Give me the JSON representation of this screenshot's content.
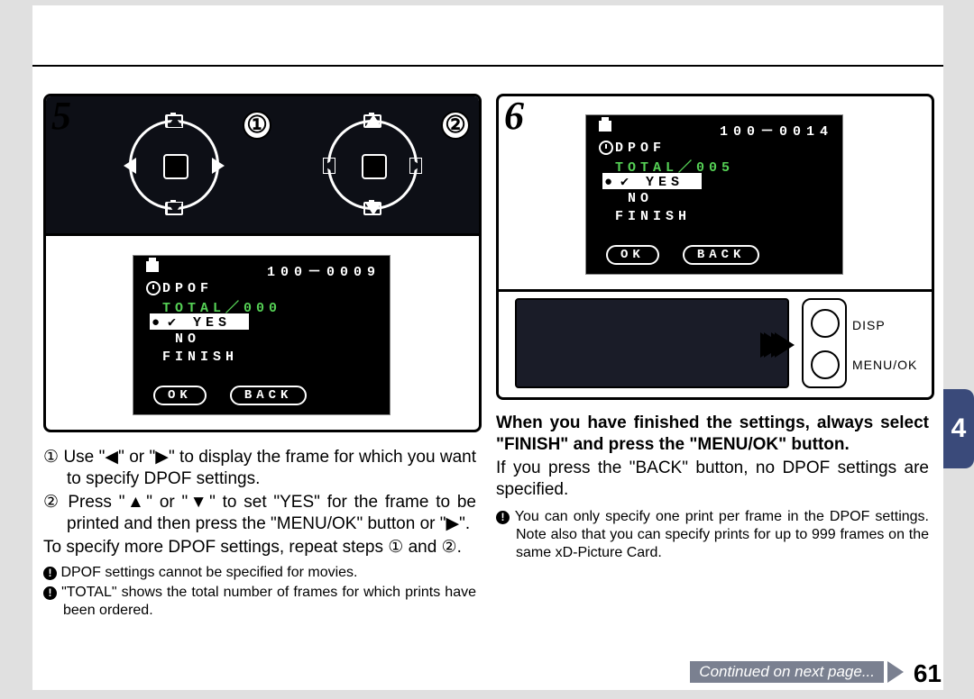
{
  "page_number": "61",
  "side_tab": "4",
  "continued": "Continued on next page...",
  "step5": {
    "num": "5",
    "circ1": "①",
    "circ2": "②",
    "lcd": {
      "file": "100－0009",
      "dpof": "DPOF",
      "total": "TOTAL／000",
      "yes": "✔ YES",
      "no": "NO",
      "finish": "FINISH",
      "ok": "OK",
      "back": "BACK"
    }
  },
  "step6": {
    "num": "6",
    "lcd": {
      "file": "100－0014",
      "dpof": "DPOF",
      "total": "TOTAL／005",
      "yes": "✔ YES",
      "no": "NO",
      "finish": "FINISH",
      "ok": "OK",
      "back": "BACK"
    },
    "btn_disp": "DISP",
    "btn_menu": "MENU/OK"
  },
  "text5": {
    "l1": "① Use \"◀\" or \"▶\" to display the frame for which you want to specify DPOF settings.",
    "l2": "② Press \"▲\" or \"▼\" to set \"YES\" for the frame to be printed and then press the \"MENU/OK\" button or \"▶\".",
    "l3": "To specify more DPOF settings, repeat steps ① and ②.",
    "n1": "DPOF settings cannot be specified for movies.",
    "n2": "\"TOTAL\" shows the total number of frames for which prints have been ordered."
  },
  "text6": {
    "b1": "When you have finished the settings, always select \"FINISH\" and press the \"MENU/OK\" button.",
    "p1": "If you press the \"BACK\" button, no DPOF settings are specified.",
    "n1": "You can only specify one print per frame in the DPOF settings. Note also that you can specify prints for up to 999 frames on the same xD-Picture Card."
  }
}
